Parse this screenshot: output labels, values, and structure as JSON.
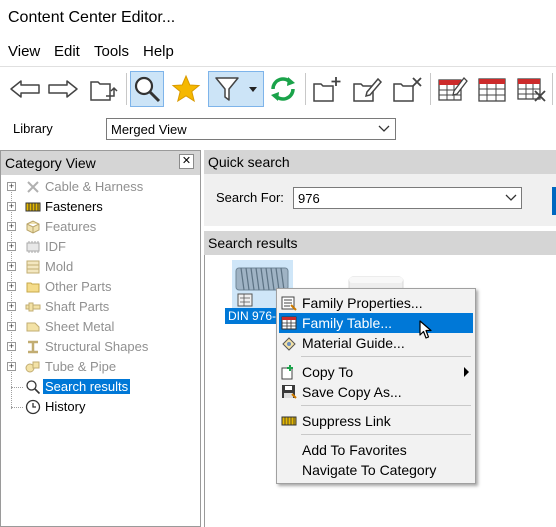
{
  "window": {
    "title": "Content Center Editor..."
  },
  "menubar": [
    {
      "label": "View"
    },
    {
      "label": "Edit"
    },
    {
      "label": "Tools"
    },
    {
      "label": "Help"
    }
  ],
  "toolbar": {
    "buttons": [
      {
        "icon": "back-arrow-icon"
      },
      {
        "icon": "forward-arrow-icon"
      },
      {
        "icon": "folder-up-icon"
      },
      {
        "icon": "search-icon",
        "active": true
      },
      {
        "icon": "favorites-star-icon"
      },
      {
        "icon": "filter-icon",
        "active": true
      },
      {
        "icon": "refresh-icon"
      },
      {
        "icon": "new-category-icon"
      },
      {
        "icon": "edit-category-icon"
      },
      {
        "icon": "delete-category-icon"
      },
      {
        "icon": "edit-family-icon"
      },
      {
        "icon": "family-table-icon"
      },
      {
        "icon": "delete-family-icon"
      }
    ]
  },
  "library": {
    "label": "Library",
    "selected": "Merged View"
  },
  "category_view": {
    "title": "Category View",
    "close_glyph": "✕",
    "items": [
      {
        "label": "Cable & Harness",
        "style": "gray",
        "icon": "cable-harness-icon",
        "expandable": true
      },
      {
        "label": "Fasteners",
        "style": "dark",
        "icon": "fasteners-icon",
        "expandable": true
      },
      {
        "label": "Features",
        "style": "gray",
        "icon": "features-icon",
        "expandable": true
      },
      {
        "label": "IDF",
        "style": "gray",
        "icon": "idf-icon",
        "expandable": true
      },
      {
        "label": "Mold",
        "style": "gray",
        "icon": "mold-icon",
        "expandable": true
      },
      {
        "label": "Other Parts",
        "style": "gray",
        "icon": "other-parts-icon",
        "expandable": true
      },
      {
        "label": "Shaft Parts",
        "style": "gray",
        "icon": "shaft-parts-icon",
        "expandable": true
      },
      {
        "label": "Sheet Metal",
        "style": "gray",
        "icon": "sheet-metal-icon",
        "expandable": true
      },
      {
        "label": "Structural Shapes",
        "style": "gray",
        "icon": "structural-shapes-icon",
        "expandable": true
      },
      {
        "label": "Tube & Pipe",
        "style": "gray",
        "icon": "tube-pipe-icon",
        "expandable": true
      },
      {
        "label": "Search results",
        "style": "selected",
        "icon": "search-icon",
        "expandable": false
      },
      {
        "label": "History",
        "style": "dark",
        "icon": "history-clock-icon",
        "expandable": false
      }
    ]
  },
  "quick_search": {
    "title": "Quick search",
    "search_for_label": "Search For:",
    "value": "976"
  },
  "search_results": {
    "title": "Search results",
    "items": [
      {
        "label": "DIN 976-",
        "selected": true
      },
      {
        "label": "",
        "selected": false
      }
    ]
  },
  "context_menu": {
    "items": [
      {
        "label": "Family Properties...",
        "icon": "family-properties-icon"
      },
      {
        "label": "Family Table...",
        "icon": "family-table-icon",
        "highlighted": true
      },
      {
        "label": "Material Guide...",
        "icon": "material-guide-icon"
      },
      {
        "separator": true
      },
      {
        "label": "Copy To",
        "icon": "copy-to-icon",
        "submenu": true
      },
      {
        "label": "Save Copy As...",
        "icon": "save-copy-icon"
      },
      {
        "separator": true
      },
      {
        "label": "Suppress Link",
        "icon": "suppress-link-icon"
      },
      {
        "separator": true
      },
      {
        "label": "Add To Favorites",
        "icon": ""
      },
      {
        "label": "Navigate To Category",
        "icon": ""
      }
    ]
  },
  "colors": {
    "selection": "#0078d7",
    "panel_header": "#d5d5d5",
    "menu_bg": "#f2f2f2",
    "active_toolbar": "#cce4f7"
  }
}
